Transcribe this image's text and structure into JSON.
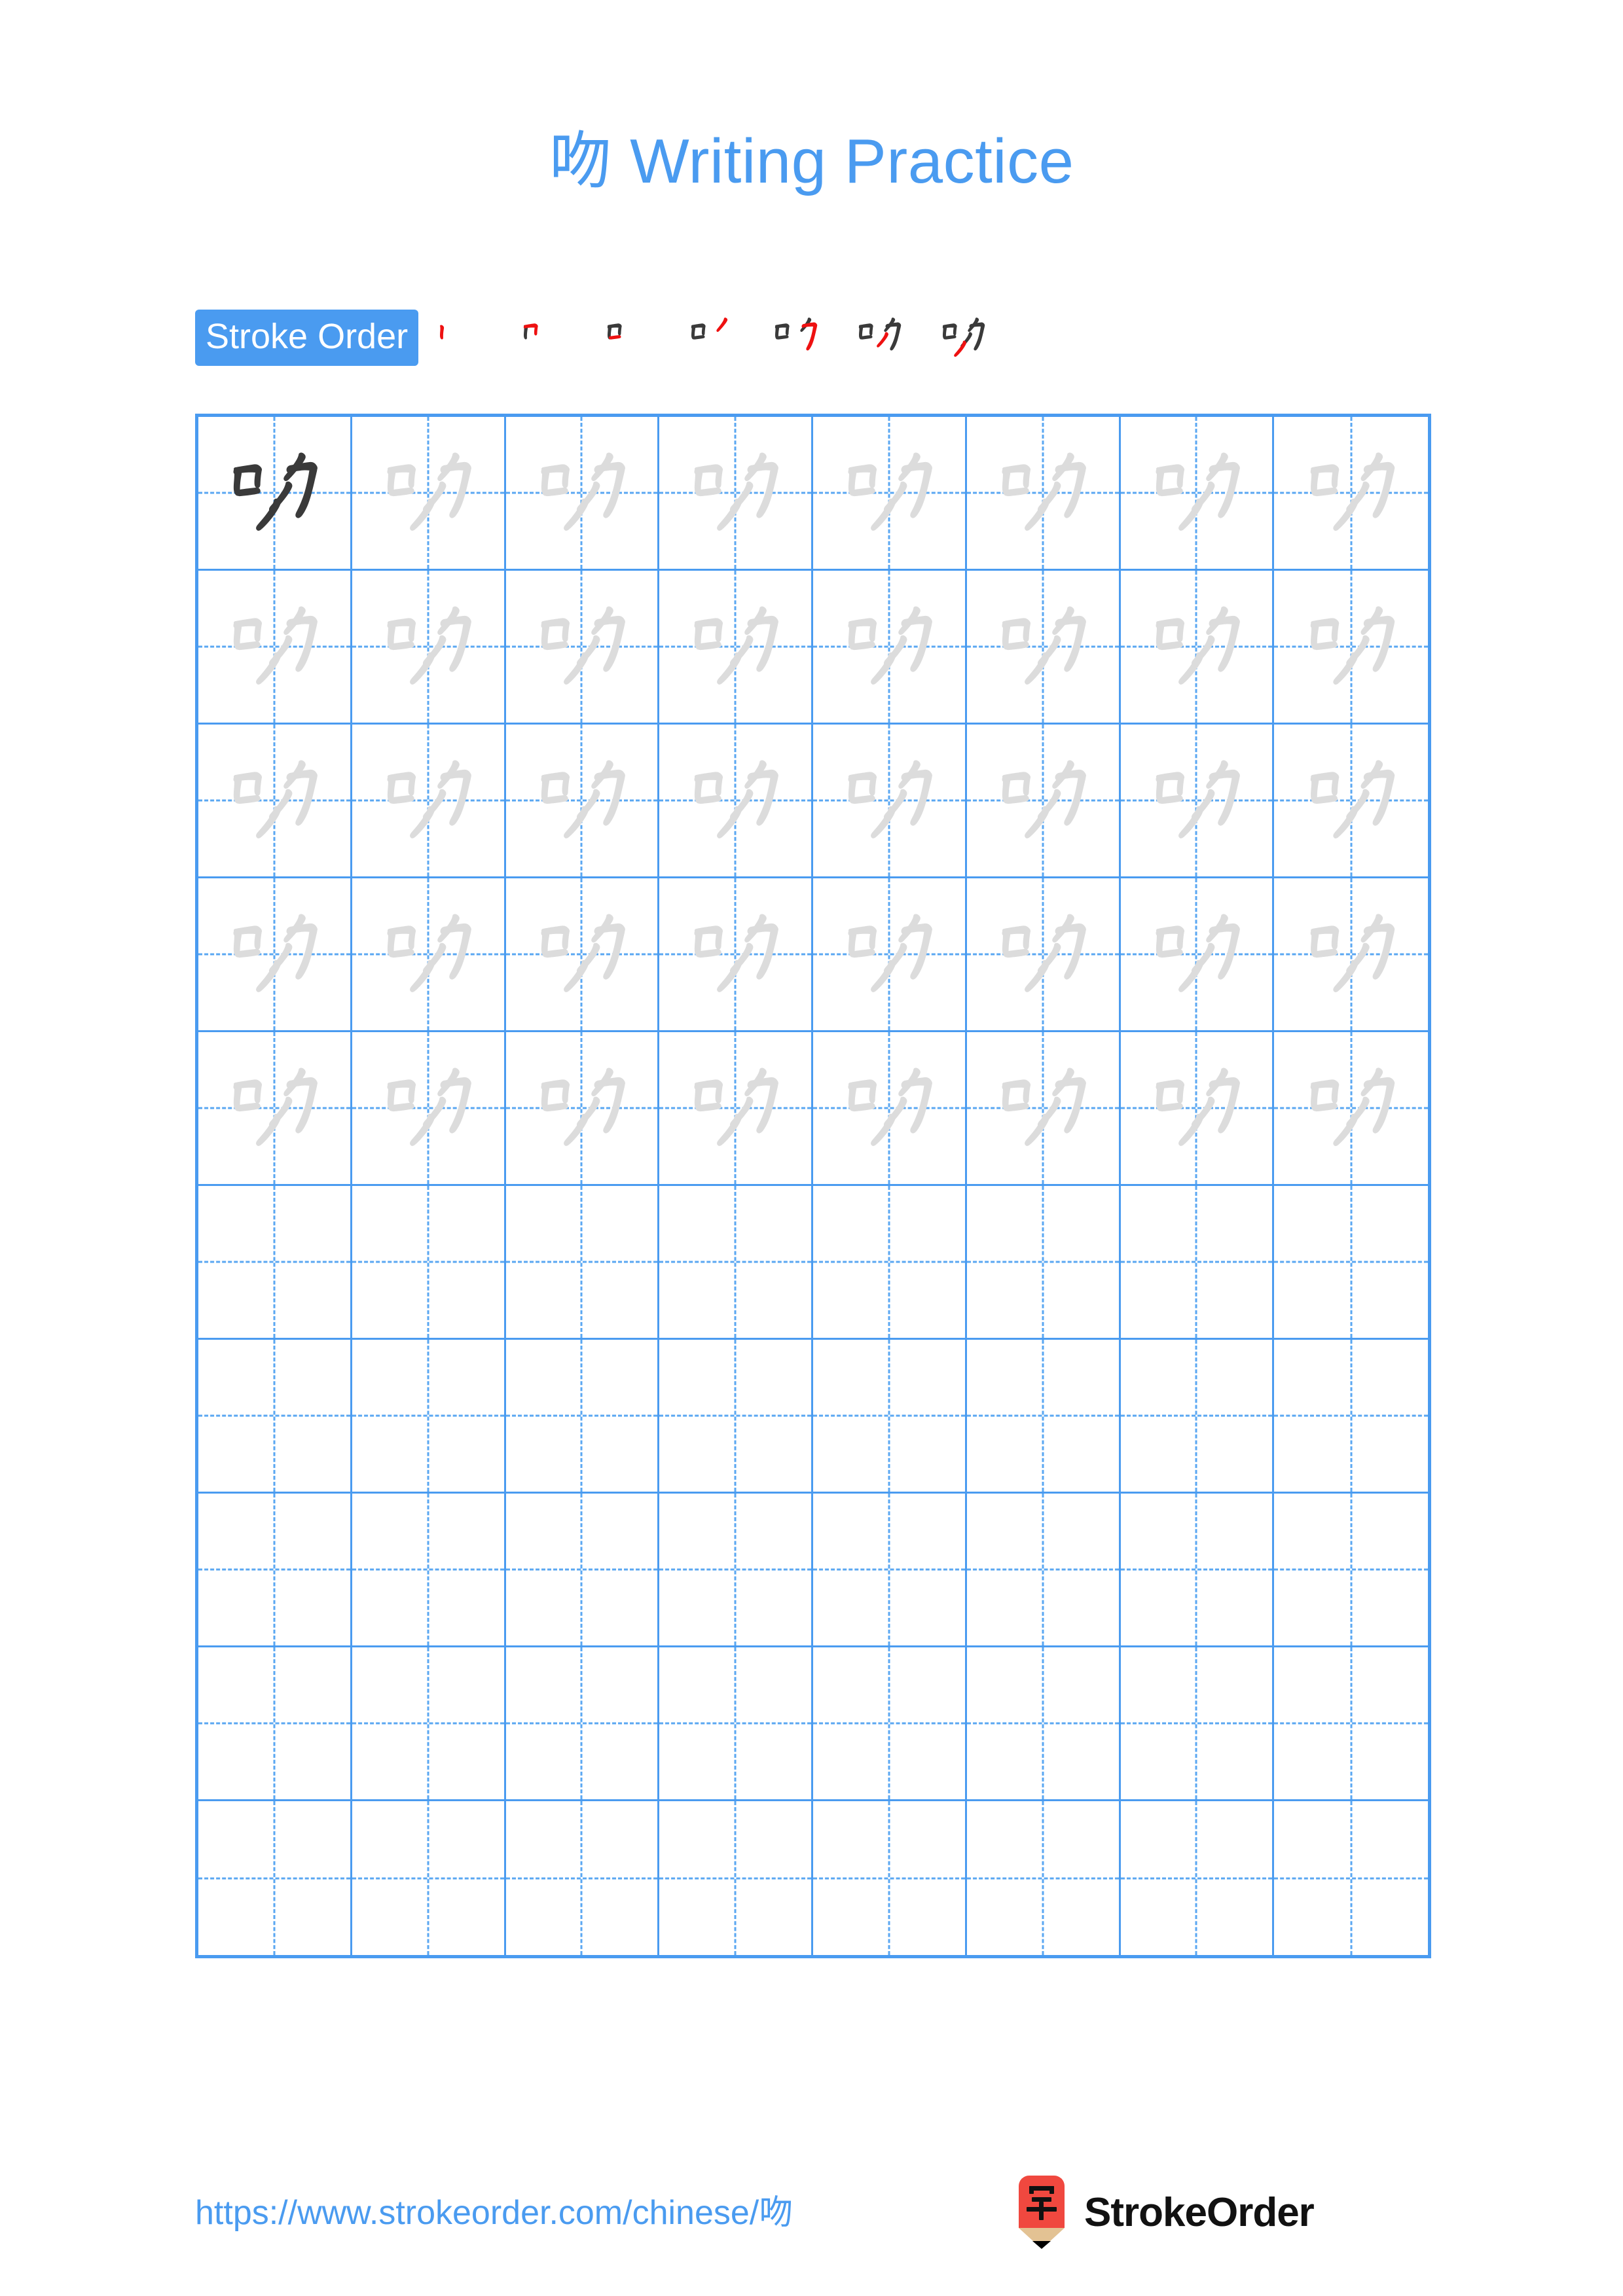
{
  "page": {
    "character": "吻",
    "title": "吻 Writing Practice",
    "background_color": "#ffffff",
    "accent_color": "#4a9bf0",
    "stroke_new_color": "#ee1111",
    "stroke_done_color": "#3a3a3a",
    "trace_color": "#dcdcdc"
  },
  "stroke_order": {
    "label": "Stroke Order",
    "stroke_count": 7,
    "steps": [
      {
        "index": 1,
        "strokes_drawn": 1,
        "glyph": "丶"
      },
      {
        "index": 2,
        "strokes_drawn": 2,
        "glyph": "冂"
      },
      {
        "index": 3,
        "strokes_drawn": 3,
        "glyph": "口"
      },
      {
        "index": 4,
        "strokes_drawn": 4,
        "glyph": "口丿"
      },
      {
        "index": 5,
        "strokes_drawn": 5,
        "glyph": "吋"
      },
      {
        "index": 6,
        "strokes_drawn": 6,
        "glyph": "吻"
      },
      {
        "index": 7,
        "strokes_drawn": 7,
        "glyph": "吻"
      }
    ]
  },
  "grid": {
    "columns": 8,
    "rows": 10,
    "filled_rows": 5,
    "empty_rows": 5,
    "model_cell": {
      "row": 1,
      "column": 1
    },
    "cell_character": "吻"
  },
  "footer": {
    "url": "https://www.strokeorder.com/chinese/吻",
    "brand_name": "StrokeOrder",
    "logo_character": "字",
    "logo_body_color": "#f0483f",
    "logo_wood_color": "#e3c293",
    "logo_tip_color": "#000000"
  }
}
